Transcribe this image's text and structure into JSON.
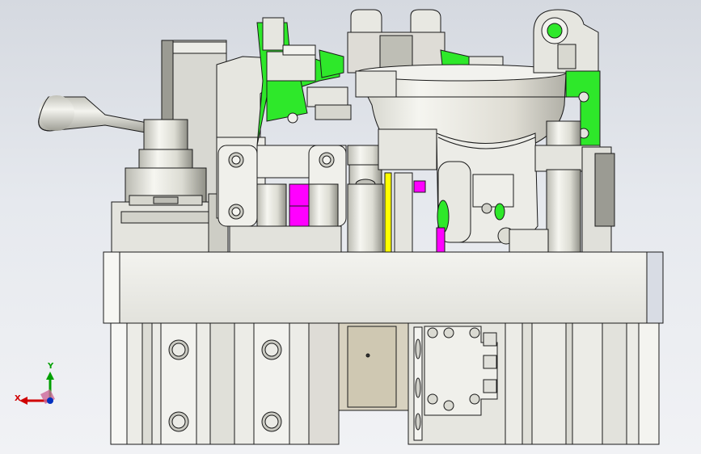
{
  "viewport": {
    "background_top": "#d5d9e0",
    "background_bottom": "#f1f2f5"
  },
  "triad": {
    "x_label": "X",
    "y_label": "Y",
    "x_color": "#d00000",
    "y_color": "#00a000",
    "z_color": "#0030c0"
  },
  "model": {
    "description_icon": "cad-fixture-assembly",
    "colors": {
      "steel": "#e8e8e2",
      "steel_dark": "#9a9a90",
      "green": "#2ee82a",
      "magenta": "#ff00ff",
      "yellow": "#ffff00",
      "edge": "#1a1a1a"
    }
  }
}
